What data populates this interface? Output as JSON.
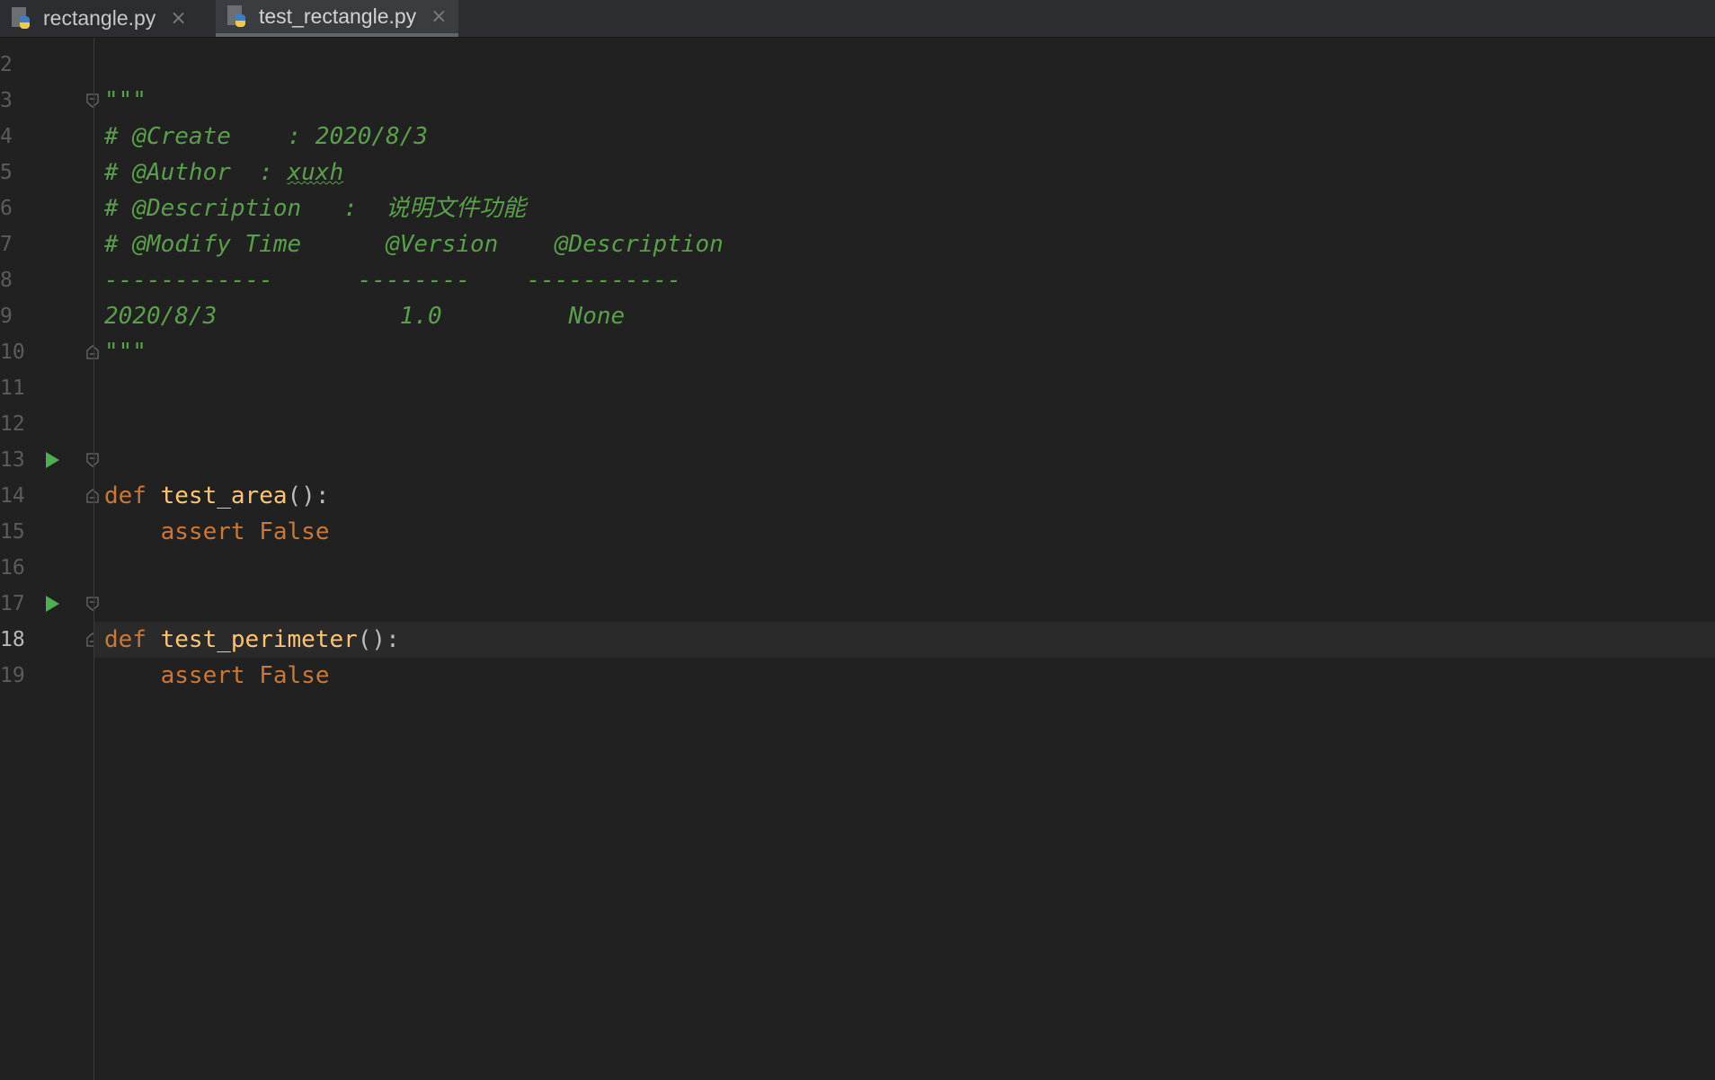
{
  "tabs": [
    {
      "label": "rectangle.py",
      "close": "×",
      "active": false
    },
    {
      "label": "test_rectangle.py",
      "close": "×",
      "active": true
    }
  ],
  "editor": {
    "current_line": "18",
    "lines": [
      {
        "num": "2",
        "text": ""
      },
      {
        "num": "3",
        "text": "\"\"\""
      },
      {
        "num": "4",
        "text": "# @Create    : 2020/8/3"
      },
      {
        "num": "5a",
        "text": "# @Author  : "
      },
      {
        "num": "5b",
        "text": "xuxh"
      },
      {
        "num": "6",
        "text": "# @Description   :  说明文件功能"
      },
      {
        "num": "7",
        "text": "# @Modify Time      @Version    @Description"
      },
      {
        "num": "8",
        "text": "------------      --------    -----------"
      },
      {
        "num": "9",
        "text": "2020/8/3             1.0         None"
      },
      {
        "num": "10",
        "text": "\"\"\""
      },
      {
        "num": "13_kw",
        "text": "def"
      },
      {
        "num": "13_fn",
        "text": "test_area"
      },
      {
        "num": "13_p",
        "text": "():"
      },
      {
        "num": "14_kw",
        "text": "assert"
      },
      {
        "num": "14_v",
        "text": "False"
      },
      {
        "num": "17_kw",
        "text": "def"
      },
      {
        "num": "17_fn",
        "text": "test_perimeter"
      },
      {
        "num": "17_p",
        "text": "():"
      },
      {
        "num": "18_kw",
        "text": "assert"
      },
      {
        "num": "18_v",
        "text": "False"
      }
    ],
    "line_numbers": [
      "2",
      "3",
      "4",
      "5",
      "6",
      "7",
      "8",
      "9",
      "10",
      "11",
      "12",
      "13",
      "14",
      "15",
      "16",
      "17",
      "18",
      "19"
    ]
  },
  "colors": {
    "docstring": "#5aa04b",
    "keyword": "#cc7832",
    "function": "#ffc66d",
    "run_icon": "#4caf50"
  },
  "icons": {
    "file_type": "python-file-icon",
    "run": "run-test-icon",
    "fold": "fold-marker-icon"
  }
}
